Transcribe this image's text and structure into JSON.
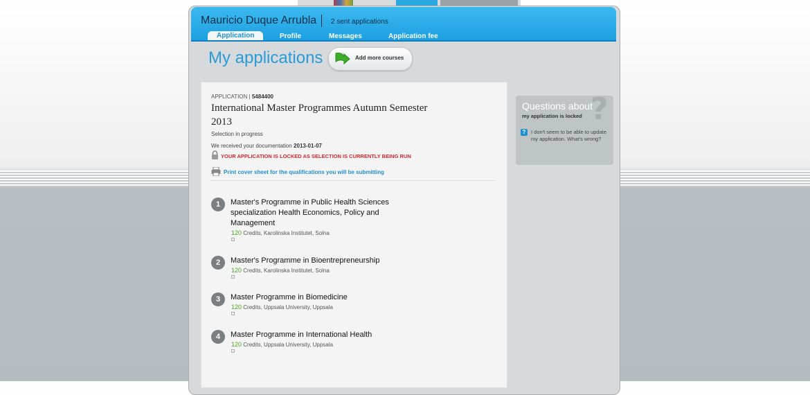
{
  "header": {
    "user_name": "Mauricio Duque Arrubla",
    "sent_applications": "2 sent applications",
    "nav": [
      "Application",
      "Profile",
      "Messages",
      "Application fee"
    ]
  },
  "main": {
    "title": "My applications",
    "add_button": "Add more courses"
  },
  "application": {
    "label": "APPLICATION |",
    "number": "5484400",
    "title": "International Master Programmes Autumn Semester 2013",
    "status": "Selection in progress",
    "received_text": "We received your documentation",
    "received_date": "2013-01-07",
    "locked_message": "YOUR APPLICATION IS LOCKED AS SELECTION IS CURRENTLY BEING RUN",
    "cover_sheet_link": "Print cover sheet for the qualifications you will be submitting",
    "courses": [
      {
        "number": "1",
        "name": "Master's Programme in Public Health Sciences specialization Health Economics, Policy and Management",
        "credits": "120",
        "info": "Credits, Karolinska Institutet, Solna"
      },
      {
        "number": "2",
        "name": "Master's Programme in Bioentrepreneurship",
        "credits": "120",
        "info": "Credits, Karolinska Institutet, Solna"
      },
      {
        "number": "3",
        "name": "Master Programme in Biomedicine",
        "credits": "120",
        "info": "Credits, Uppsala University, Uppsala"
      },
      {
        "number": "4",
        "name": "Master Programme in International Health",
        "credits": "120",
        "info": "Credits, Uppsala University, Uppsala"
      }
    ]
  },
  "questions": {
    "title": "Questions about",
    "subtitle": "my application is locked",
    "help_glyph": "?",
    "link": "I don't seem to be able to update my application. What's wrong?"
  },
  "colors": {
    "header_blue": "#1c9fe0",
    "title_blue": "#2a9ad8",
    "locked_red": "#d8262b",
    "credits_green": "#4aa81e"
  },
  "icons": [
    "lock-icon",
    "printer-icon",
    "download-arrow-icon",
    "help-icon",
    "question-mark-icon"
  ]
}
